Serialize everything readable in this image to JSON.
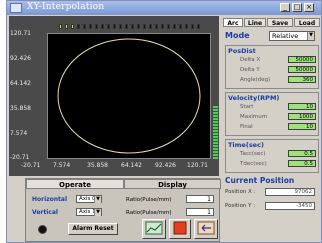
{
  "window": {
    "title": "XY-Interpolation",
    "min_glyph": "_",
    "max_glyph": "□",
    "close_glyph": "×"
  },
  "plot": {
    "y_ticks": [
      "120.71",
      "92.426",
      "64.142",
      "35.858",
      "7.574",
      "-20.71"
    ],
    "x_ticks": [
      "-20.71",
      "7.574",
      "35.858",
      "64.142",
      "92.426",
      "120.71"
    ],
    "curve_color": "#e8dfa0",
    "background": "#000000"
  },
  "operate": {
    "tabs": [
      "Operate",
      "Display"
    ],
    "horizontal_label": "Horizontal",
    "vertical_label": "Vertical",
    "horizontal_axis": "Axis 0",
    "vertical_axis": "Axis 1",
    "ratio_label": "Ratio(Pulse/mm)",
    "horizontal_ratio": "1",
    "vertical_ratio": "1",
    "alarm_reset": "Alarm Reset"
  },
  "right": {
    "tabs": [
      "Arc",
      "Line",
      "Save",
      "Load"
    ],
    "mode_label": "Mode",
    "mode_value": "Relative",
    "posdist": {
      "title": "PosDist",
      "fields": [
        {
          "label": "Delta X",
          "value": "50000"
        },
        {
          "label": "Delta Y",
          "value": "50000"
        },
        {
          "label": "Angle(deg)",
          "value": "360"
        }
      ]
    },
    "velocity": {
      "title": "Velocity(RPM)",
      "fields": [
        {
          "label": "Start",
          "value": "10"
        },
        {
          "label": "Maximum",
          "value": "1000"
        },
        {
          "label": "Final",
          "value": "10"
        }
      ]
    },
    "time": {
      "title": "Time(sec)",
      "fields": [
        {
          "label": "Tacc(sec)",
          "value": "0.5"
        },
        {
          "label": "Tdec(sec)",
          "value": "0.5"
        }
      ]
    },
    "current": {
      "title": "Current Position",
      "x_label": "Position X :",
      "y_label": "Position Y :",
      "x_value": "97062",
      "y_value": "-3450"
    }
  }
}
